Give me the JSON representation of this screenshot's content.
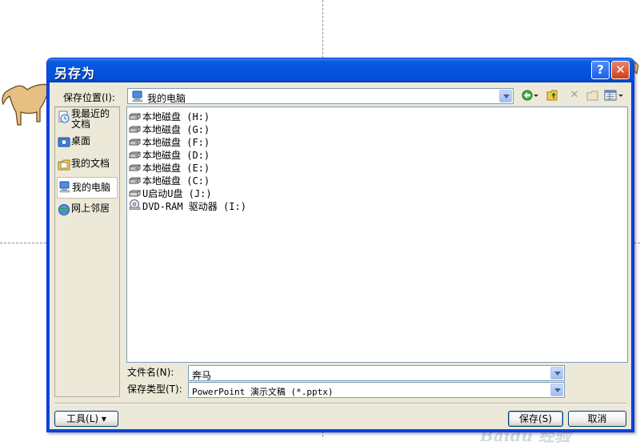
{
  "dialog": {
    "title": "另存为",
    "help_label": "?",
    "close_label": "✕"
  },
  "lookin": {
    "label": "保存位置(I):",
    "value": "我的电脑"
  },
  "places": [
    {
      "label": "我最近的文档",
      "icon": "recent-documents-icon"
    },
    {
      "label": "桌面",
      "icon": "desktop-icon"
    },
    {
      "label": "我的文档",
      "icon": "my-documents-icon"
    },
    {
      "label": "我的电脑",
      "icon": "my-computer-icon"
    },
    {
      "label": "网上邻居",
      "icon": "network-places-icon"
    }
  ],
  "files": [
    {
      "label": "本地磁盘 (H:)",
      "icon": "hard-drive-icon"
    },
    {
      "label": "本地磁盘 (G:)",
      "icon": "hard-drive-icon"
    },
    {
      "label": "本地磁盘 (F:)",
      "icon": "hard-drive-icon"
    },
    {
      "label": "本地磁盘 (D:)",
      "icon": "hard-drive-icon"
    },
    {
      "label": "本地磁盘 (E:)",
      "icon": "hard-drive-icon"
    },
    {
      "label": "本地磁盘 (C:)",
      "icon": "hard-drive-icon"
    },
    {
      "label": "U启动U盘 (J:)",
      "icon": "usb-drive-icon"
    },
    {
      "label": "DVD-RAM 驱动器 (I:)",
      "icon": "dvd-drive-icon"
    }
  ],
  "filename": {
    "label": "文件名(N):",
    "value": "奔马"
  },
  "filetype": {
    "label": "保存类型(T):",
    "value": "PowerPoint 演示文稿 (*.pptx)"
  },
  "buttons": {
    "tools": "工具(L) ▾",
    "save": "保存(S)",
    "cancel": "取消"
  },
  "toolbar": {
    "delete_label": "✕"
  },
  "watermark": "Baidu 经验"
}
